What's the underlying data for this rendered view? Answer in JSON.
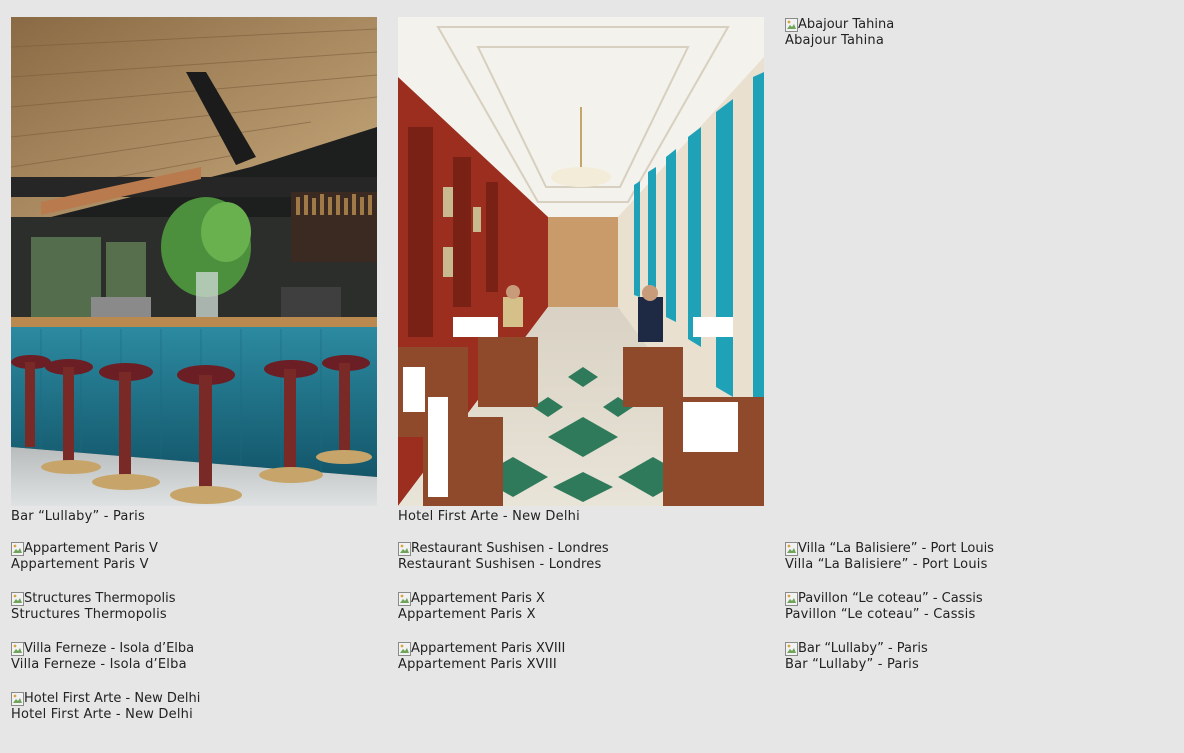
{
  "gallery": {
    "featured": [
      {
        "title": "Bar “Lullaby” - Paris",
        "image": "bar-lullaby-photo"
      },
      {
        "title": "Hotel First Arte - New Delhi",
        "image": "hotel-first-arte-photo"
      },
      {
        "title": "Abajour Tahina",
        "broken": true
      }
    ],
    "items": [
      {
        "title": "Appartement Paris V"
      },
      {
        "title": "Restaurant Sushisen - Londres"
      },
      {
        "title": "Villa “La Balisiere” - Port Louis"
      },
      {
        "title": "Structures Thermopolis"
      },
      {
        "title": "Appartement Paris X"
      },
      {
        "title": "Pavillon “Le coteau” - Cassis"
      },
      {
        "title": "Villa Ferneze - Isola d’Elba"
      },
      {
        "title": "Appartement Paris XVIII"
      },
      {
        "title": "Bar “Lullaby” - Paris"
      },
      {
        "title": "Hotel First Arte - New Delhi"
      }
    ]
  },
  "colors": {
    "page_background": "#e6e6e6",
    "text": "#222222"
  },
  "icons": {
    "broken_image": "broken-image-icon"
  }
}
